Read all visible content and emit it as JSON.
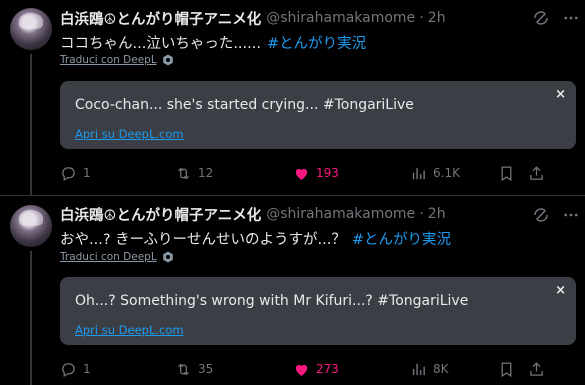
{
  "tweets": [
    {
      "display_name": "白浜鴎☮とんがり帽子アニメ化",
      "handle": "@shirahamakamome",
      "separator": "·",
      "time": "2h",
      "text": "ココちゃん...泣いちゃった......",
      "hashtag": "#とんがり実況",
      "translate_link": "Traduci con DeepL",
      "translation_text": "Coco-chan... she's started crying... #TongariLive",
      "open_deepl": "Apri su DeepL.com",
      "close_symbol": "×",
      "replies": "1",
      "reposts": "12",
      "likes": "193",
      "views": "6.1K",
      "liked": true
    },
    {
      "display_name": "白浜鴎☮とんがり帽子アニメ化",
      "handle": "@shirahamakamome",
      "separator": "·",
      "time": "2h",
      "text": "おや...? きーふりーせんせいのようすが...？",
      "hashtag": "#とんがり実況",
      "translate_link": "Traduci con DeepL",
      "translation_text": "Oh...? Something's wrong with Mr Kifuri...? #TongariLive",
      "open_deepl": "Apri su DeepL.com",
      "close_symbol": "×",
      "replies": "1",
      "reposts": "35",
      "likes": "273",
      "views": "8K",
      "liked": true
    }
  ],
  "colors": {
    "background": "#000000",
    "text": "#e7e9ea",
    "muted": "#71767b",
    "link": "#1d9bf0",
    "like": "#f91880",
    "card": "#3b3f45"
  },
  "icons": [
    "reply-icon",
    "repost-icon",
    "like-icon",
    "views-icon",
    "bookmark-icon",
    "share-icon",
    "grok-icon",
    "more-icon",
    "deepl-icon"
  ]
}
